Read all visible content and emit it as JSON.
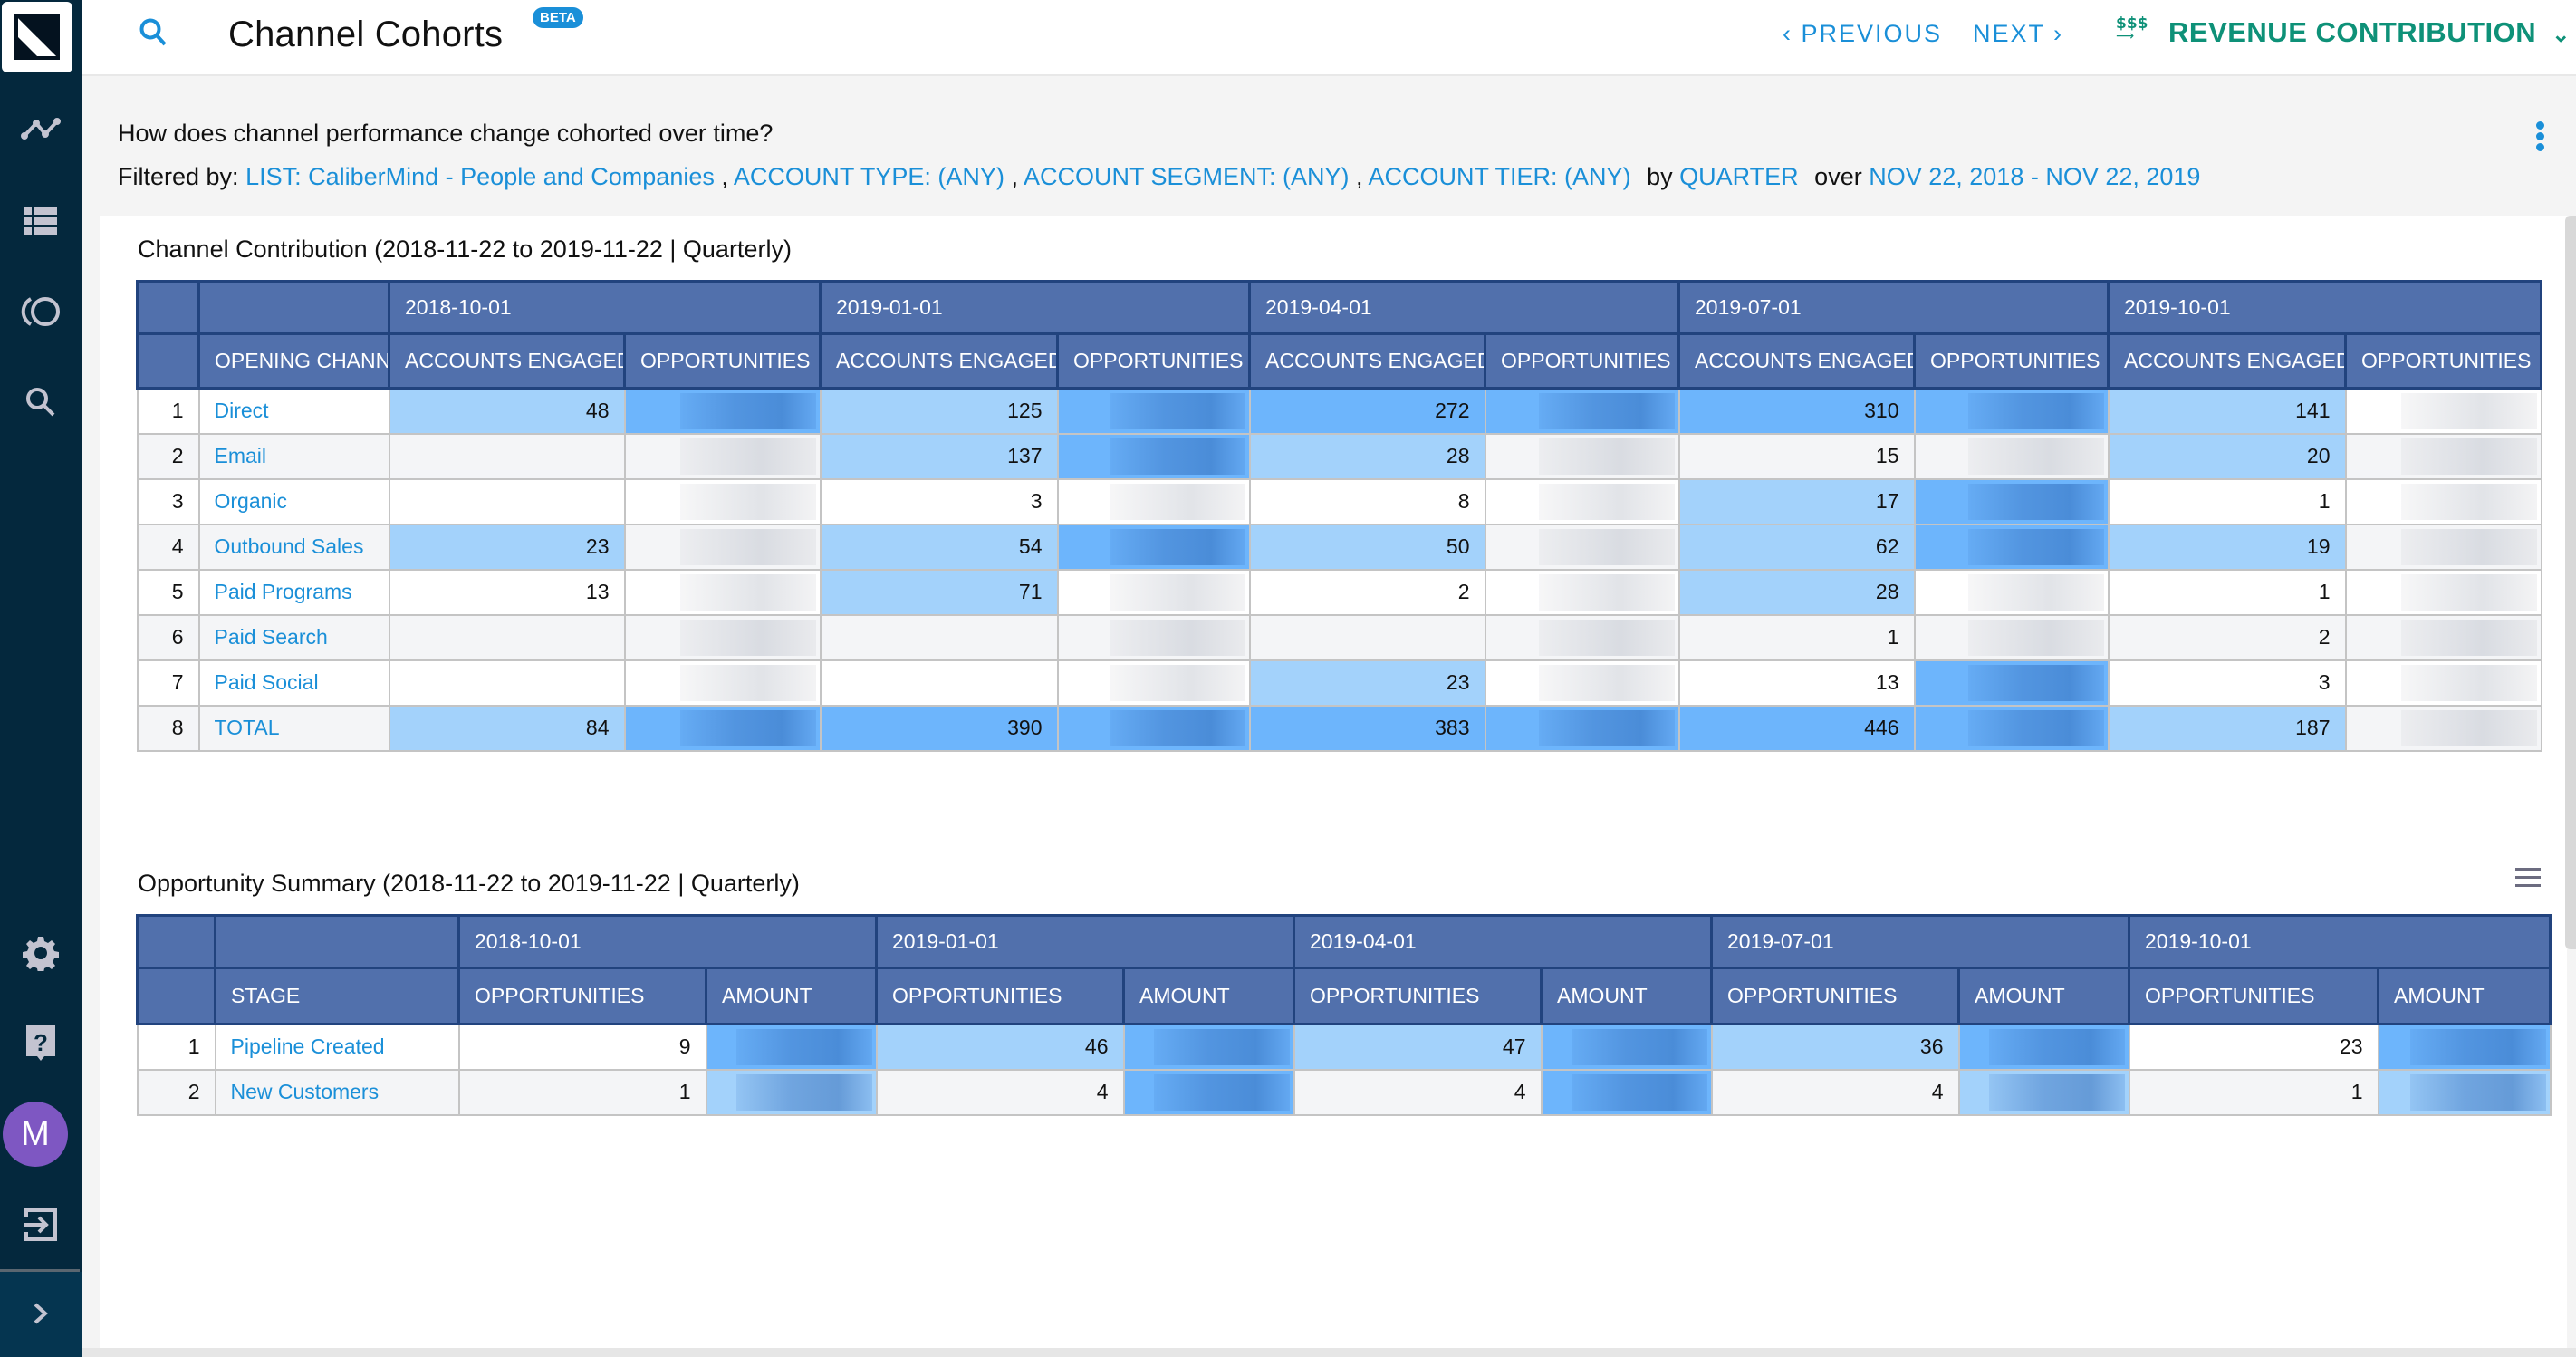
{
  "header": {
    "title": "Channel Cohorts",
    "badge": "BETA",
    "prev_label": "PREVIOUS",
    "next_label": "NEXT",
    "report_icon": "$$$",
    "report_selector": "REVENUE CONTRIBUTION"
  },
  "sidebar": {
    "items": [
      {
        "icon": "trend-line-icon",
        "label": "Trends"
      },
      {
        "icon": "list-icon",
        "label": "Reports"
      },
      {
        "icon": "cohort-circles-icon",
        "label": "Cohorts"
      },
      {
        "icon": "search-icon",
        "label": "Search"
      },
      {
        "icon": "gear-icon",
        "label": "Settings"
      },
      {
        "icon": "help-icon",
        "label": "Help"
      },
      {
        "icon": "logout-icon",
        "label": "Log out"
      },
      {
        "icon": "chevron-right-icon",
        "label": "Expand"
      }
    ],
    "avatar_initial": "M",
    "avatar_color": "#7e57c2"
  },
  "subheader": {
    "question": "How does channel performance change cohorted over time?",
    "filtered_by_label": "Filtered by:",
    "filters": [
      "LIST: CaliberMind - People and Companies",
      "ACCOUNT TYPE: (ANY)",
      "ACCOUNT SEGMENT: (ANY)",
      "ACCOUNT TIER: (ANY)"
    ],
    "by_label": "by",
    "period": "QUARTER",
    "over_label": "over",
    "date_range": "NOV 22, 2018 - NOV 22, 2019"
  },
  "colors": {
    "accent": "#1a8fd8",
    "revenue_green": "#0e9178",
    "header_blue": "#5170ac",
    "heat_light": "#a3d2fb",
    "heat_strong": "#6db5fc",
    "sidebar_bg": "#04283d"
  },
  "channel_table": {
    "title": "Channel Contribution (2018-11-22 to 2019-11-22 | Quarterly)",
    "row_header_label": "OPENING CHANN",
    "periods": [
      "2018-10-01",
      "2019-01-01",
      "2019-04-01",
      "2019-07-01",
      "2019-10-01"
    ],
    "metric_labels": [
      "ACCOUNTS ENGAGED",
      "OPPORTUNITIES"
    ],
    "rows": [
      {
        "idx": "1",
        "name": "Direct",
        "accounts": [
          "48",
          "125",
          "272",
          "310",
          "141"
        ],
        "heat": [
          1,
          1,
          2,
          2,
          1
        ],
        "opp_heat": [
          2,
          2,
          2,
          2,
          0
        ]
      },
      {
        "idx": "2",
        "name": "Email",
        "accounts": [
          "",
          "137",
          "28",
          "15",
          "20"
        ],
        "heat": [
          0,
          1,
          1,
          0,
          1
        ],
        "opp_heat": [
          0,
          2,
          0,
          0,
          0
        ]
      },
      {
        "idx": "3",
        "name": "Organic",
        "accounts": [
          "",
          "3",
          "8",
          "17",
          "1"
        ],
        "heat": [
          0,
          0,
          0,
          1,
          0
        ],
        "opp_heat": [
          0,
          0,
          0,
          2,
          0
        ]
      },
      {
        "idx": "4",
        "name": "Outbound Sales",
        "accounts": [
          "23",
          "54",
          "50",
          "62",
          "19"
        ],
        "heat": [
          1,
          1,
          1,
          1,
          1
        ],
        "opp_heat": [
          0,
          2,
          0,
          2,
          0
        ]
      },
      {
        "idx": "5",
        "name": "Paid Programs",
        "accounts": [
          "13",
          "71",
          "2",
          "28",
          "1"
        ],
        "heat": [
          0,
          1,
          0,
          1,
          0
        ],
        "opp_heat": [
          0,
          0,
          0,
          0,
          0
        ]
      },
      {
        "idx": "6",
        "name": "Paid Search",
        "accounts": [
          "",
          "",
          "",
          "1",
          "2"
        ],
        "heat": [
          0,
          0,
          0,
          0,
          0
        ],
        "opp_heat": [
          0,
          0,
          0,
          0,
          0
        ]
      },
      {
        "idx": "7",
        "name": "Paid Social",
        "accounts": [
          "",
          "",
          "23",
          "13",
          "3"
        ],
        "heat": [
          0,
          0,
          1,
          0,
          0
        ],
        "opp_heat": [
          0,
          0,
          0,
          2,
          0
        ]
      },
      {
        "idx": "8",
        "name": "TOTAL",
        "accounts": [
          "84",
          "390",
          "383",
          "446",
          "187"
        ],
        "heat": [
          1,
          2,
          2,
          2,
          1
        ],
        "opp_heat": [
          2,
          2,
          2,
          2,
          0
        ]
      }
    ],
    "opportunities_redacted": true
  },
  "opportunity_table": {
    "title": "Opportunity Summary (2018-11-22 to 2019-11-22 | Quarterly)",
    "row_header_label": "STAGE",
    "periods": [
      "2018-10-01",
      "2019-01-01",
      "2019-04-01",
      "2019-07-01",
      "2019-10-01"
    ],
    "metric_labels": [
      "OPPORTUNITIES",
      "AMOUNT"
    ],
    "rows": [
      {
        "idx": "1",
        "name": "Pipeline Created",
        "opportunities": [
          "9",
          "46",
          "47",
          "36",
          "23"
        ],
        "heat": [
          0,
          1,
          1,
          1,
          0
        ],
        "amt_heat": [
          2,
          2,
          2,
          2,
          2
        ]
      },
      {
        "idx": "2",
        "name": "New Customers",
        "opportunities": [
          "1",
          "4",
          "4",
          "4",
          "1"
        ],
        "heat": [
          0,
          0,
          0,
          0,
          0
        ],
        "amt_heat": [
          1,
          2,
          2,
          1,
          1
        ]
      }
    ],
    "amounts_redacted": true
  }
}
